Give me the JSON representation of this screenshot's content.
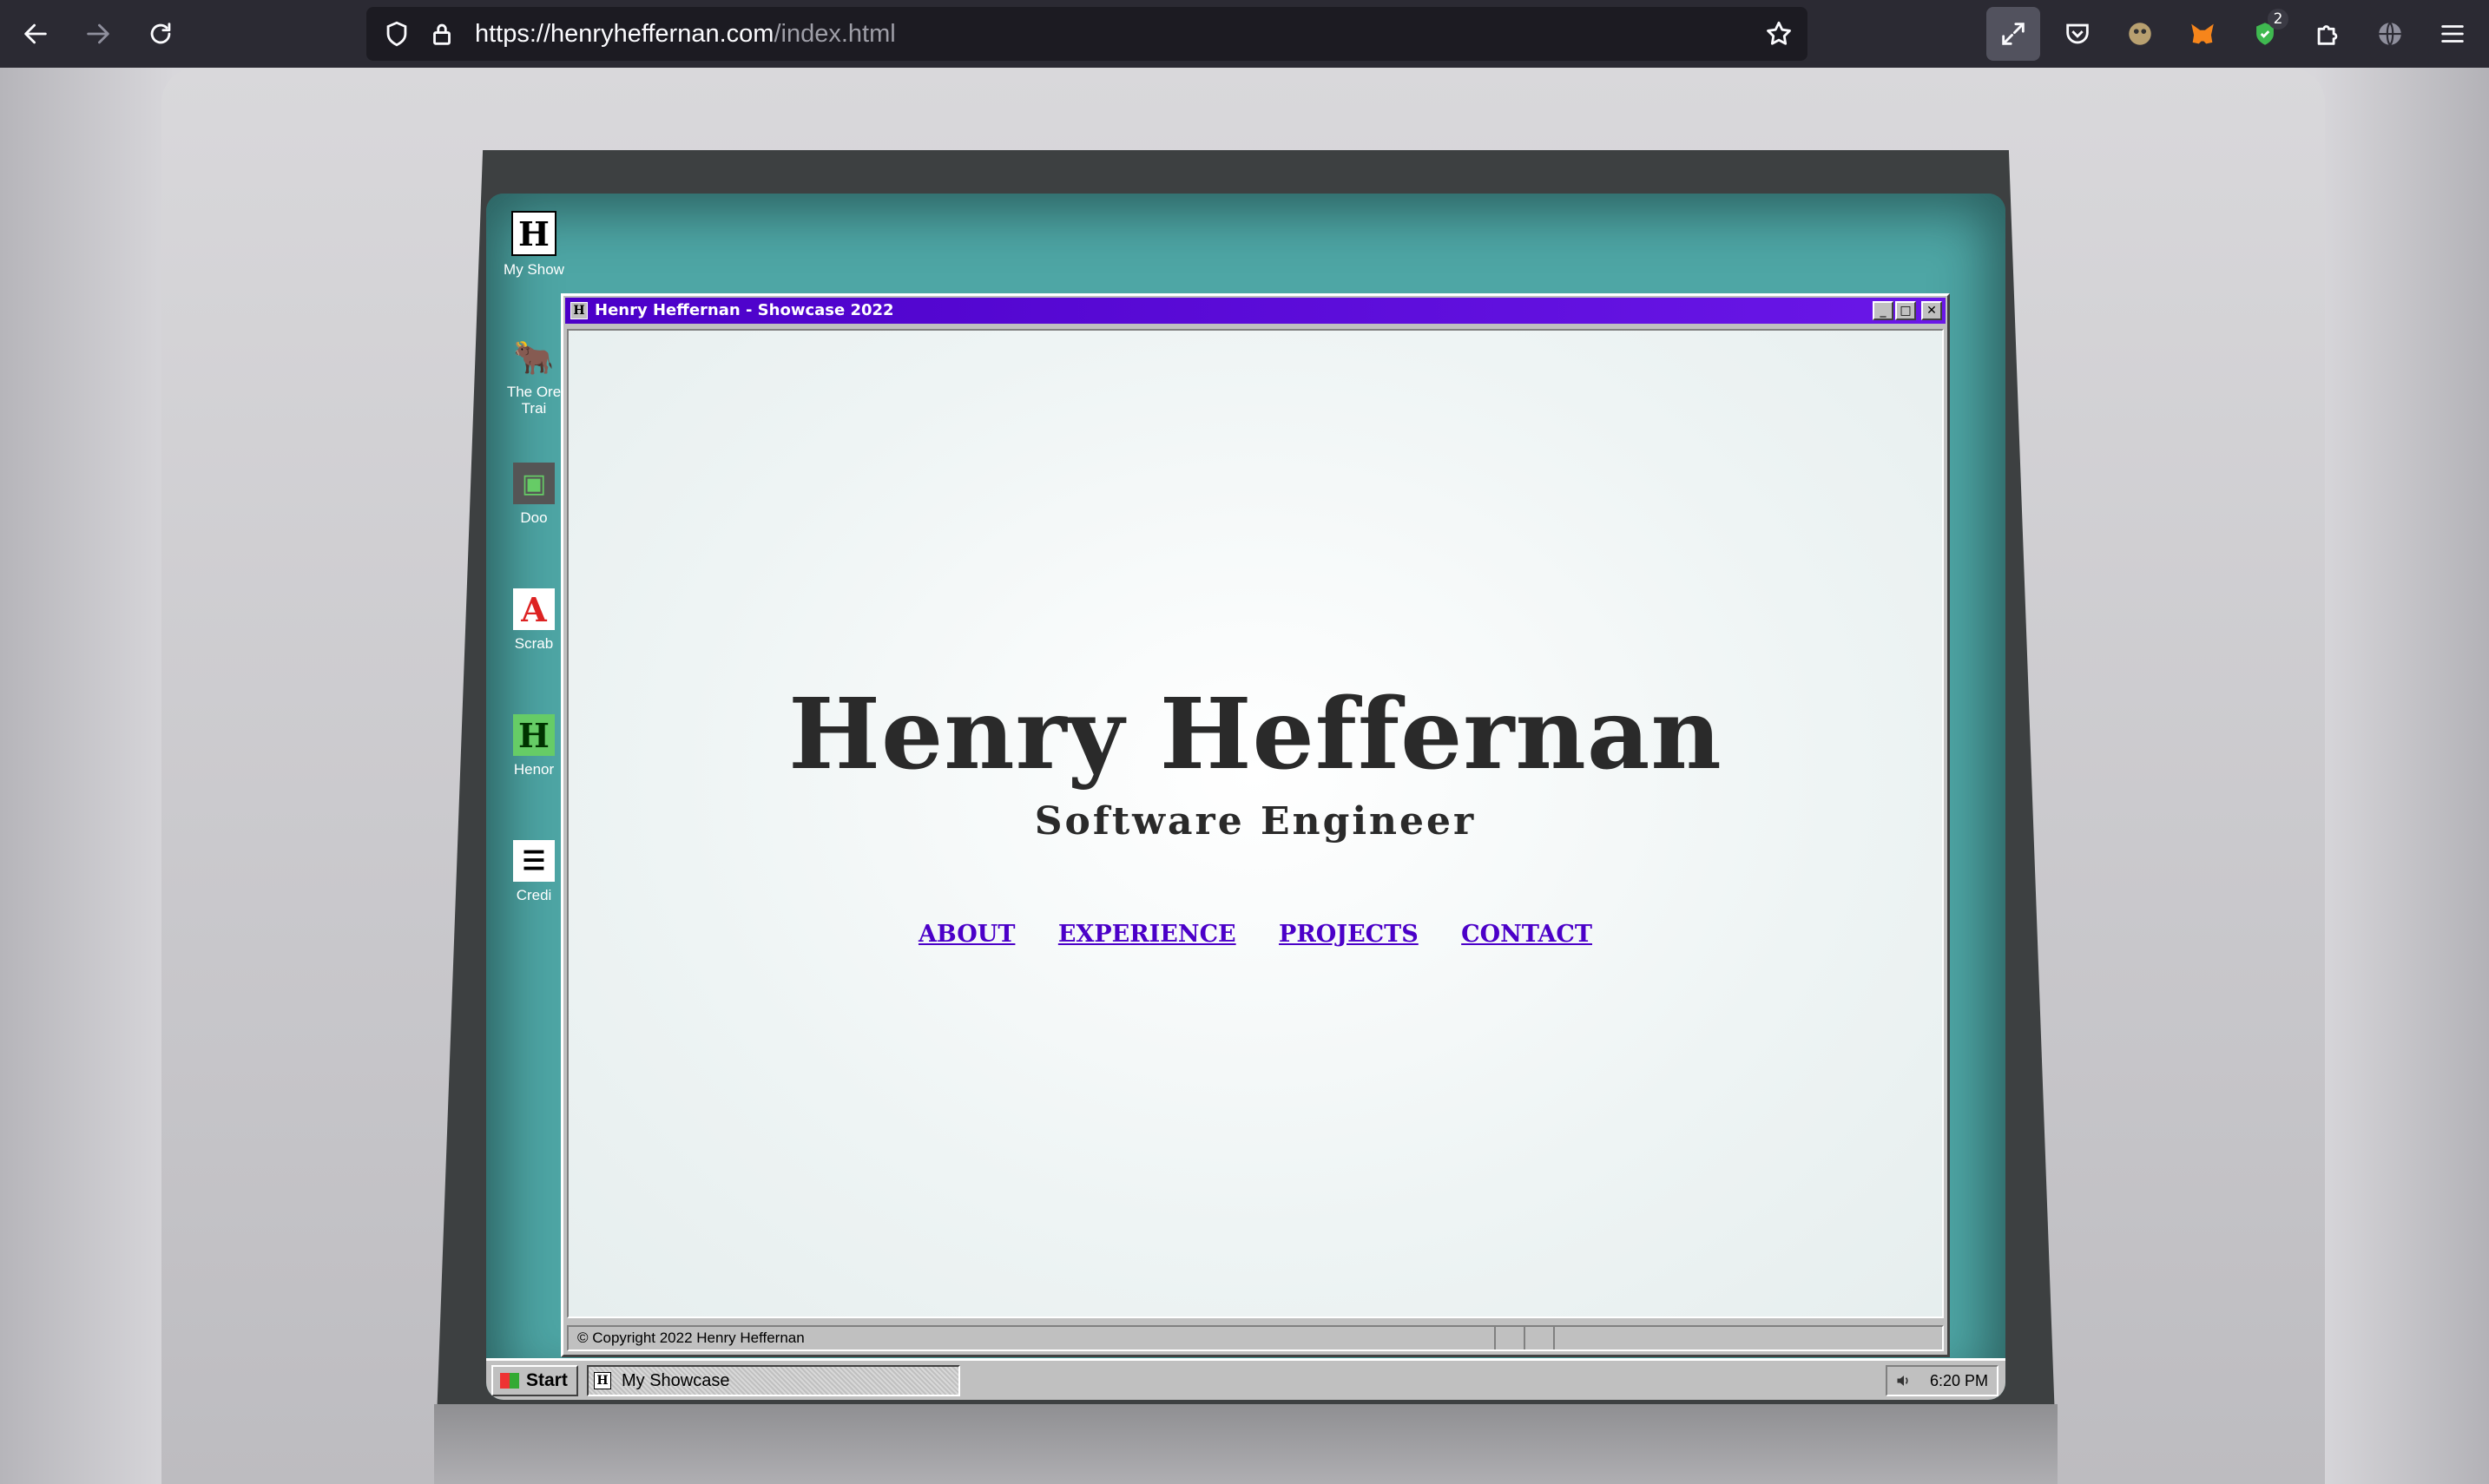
{
  "browser": {
    "url_host": "https://henryheffernan.com",
    "url_path": "/index.html",
    "extension_badge": "2"
  },
  "desktop": {
    "icons": [
      {
        "label": "My Show",
        "glyph": "H"
      },
      {
        "label": "The Ore\nTrai",
        "glyph": "🐂"
      },
      {
        "label": "Doo",
        "glyph": "▣"
      },
      {
        "label": "Scrab",
        "glyph": "A"
      },
      {
        "label": "Henor",
        "glyph": "H"
      },
      {
        "label": "Credi",
        "glyph": "☰"
      }
    ]
  },
  "window": {
    "title": "Henry Heffernan - Showcase 2022",
    "icon_glyph": "H",
    "controls": {
      "minimize": "_",
      "maximize": "□",
      "close": "✕"
    }
  },
  "hero": {
    "name": "Henry Heffernan",
    "subtitle": "Software Engineer"
  },
  "nav": [
    "ABOUT",
    "EXPERIENCE",
    "PROJECTS",
    "CONTACT"
  ],
  "status": {
    "copyright": "© Copyright 2022 Henry Heffernan"
  },
  "taskbar": {
    "start_label": "Start",
    "task_label": "My Showcase",
    "task_glyph": "H",
    "clock": "6:20 PM"
  }
}
